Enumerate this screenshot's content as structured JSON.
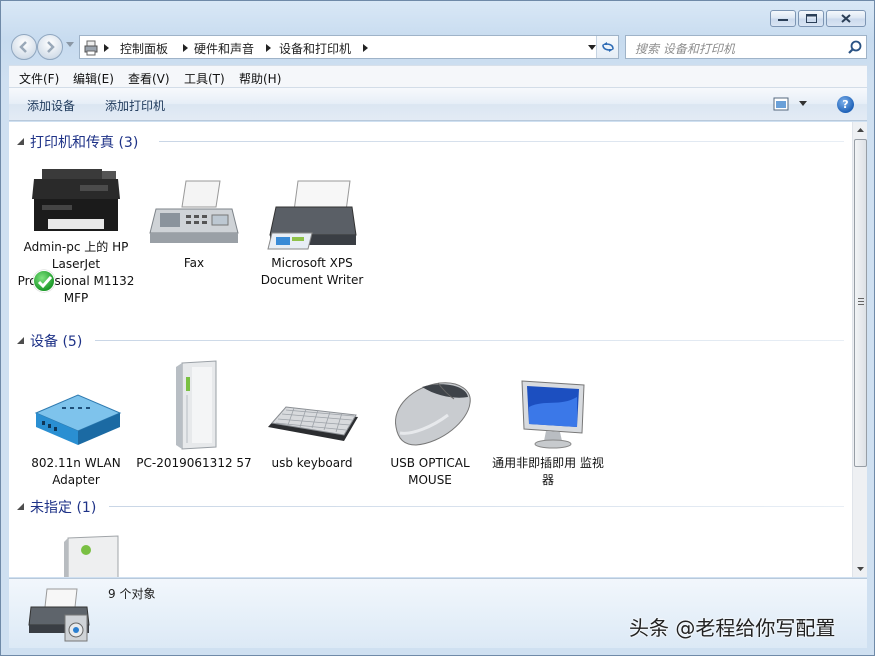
{
  "window": {
    "caption_buttons": [
      "minimize",
      "maximize",
      "close"
    ]
  },
  "address_bar": {
    "breadcrumbs": [
      "控制面板",
      "硬件和声音",
      "设备和打印机"
    ]
  },
  "search": {
    "placeholder": "搜索 设备和打印机"
  },
  "menu": {
    "items": [
      "文件(F)",
      "编辑(E)",
      "查看(V)",
      "工具(T)",
      "帮助(H)"
    ]
  },
  "toolbar": {
    "add_device": "添加设备",
    "add_printer": "添加打印机",
    "help": "?"
  },
  "groups": [
    {
      "title": "打印机和传真 (3)",
      "items": [
        {
          "label": "Admin-pc 上的 HP LaserJet Professional M1132 MFP",
          "icon": "laserjet-mfp-icon",
          "default": true
        },
        {
          "label": "Fax",
          "icon": "fax-icon"
        },
        {
          "label": "Microsoft XPS Document Writer",
          "icon": "xps-printer-icon"
        }
      ]
    },
    {
      "title": "设备 (5)",
      "items": [
        {
          "label": "802.11n WLAN Adapter",
          "icon": "wlan-adapter-icon"
        },
        {
          "label": "PC-2019061312 57",
          "icon": "computer-tower-icon"
        },
        {
          "label": "usb keyboard",
          "icon": "keyboard-icon"
        },
        {
          "label": "USB OPTICAL MOUSE",
          "icon": "mouse-icon"
        },
        {
          "label": "通用非即插即用 监视器",
          "icon": "monitor-icon"
        }
      ]
    },
    {
      "title": "未指定 (1)",
      "items": [
        {
          "label": "",
          "icon": "unspecified-device-icon"
        }
      ]
    }
  ],
  "details": {
    "count": "9 个对象"
  },
  "watermark": "头条 @老程给你写配置",
  "colors": {
    "group_title": "#1e3287",
    "command_text": "#1e395b",
    "content_bg": "#ffffff"
  }
}
